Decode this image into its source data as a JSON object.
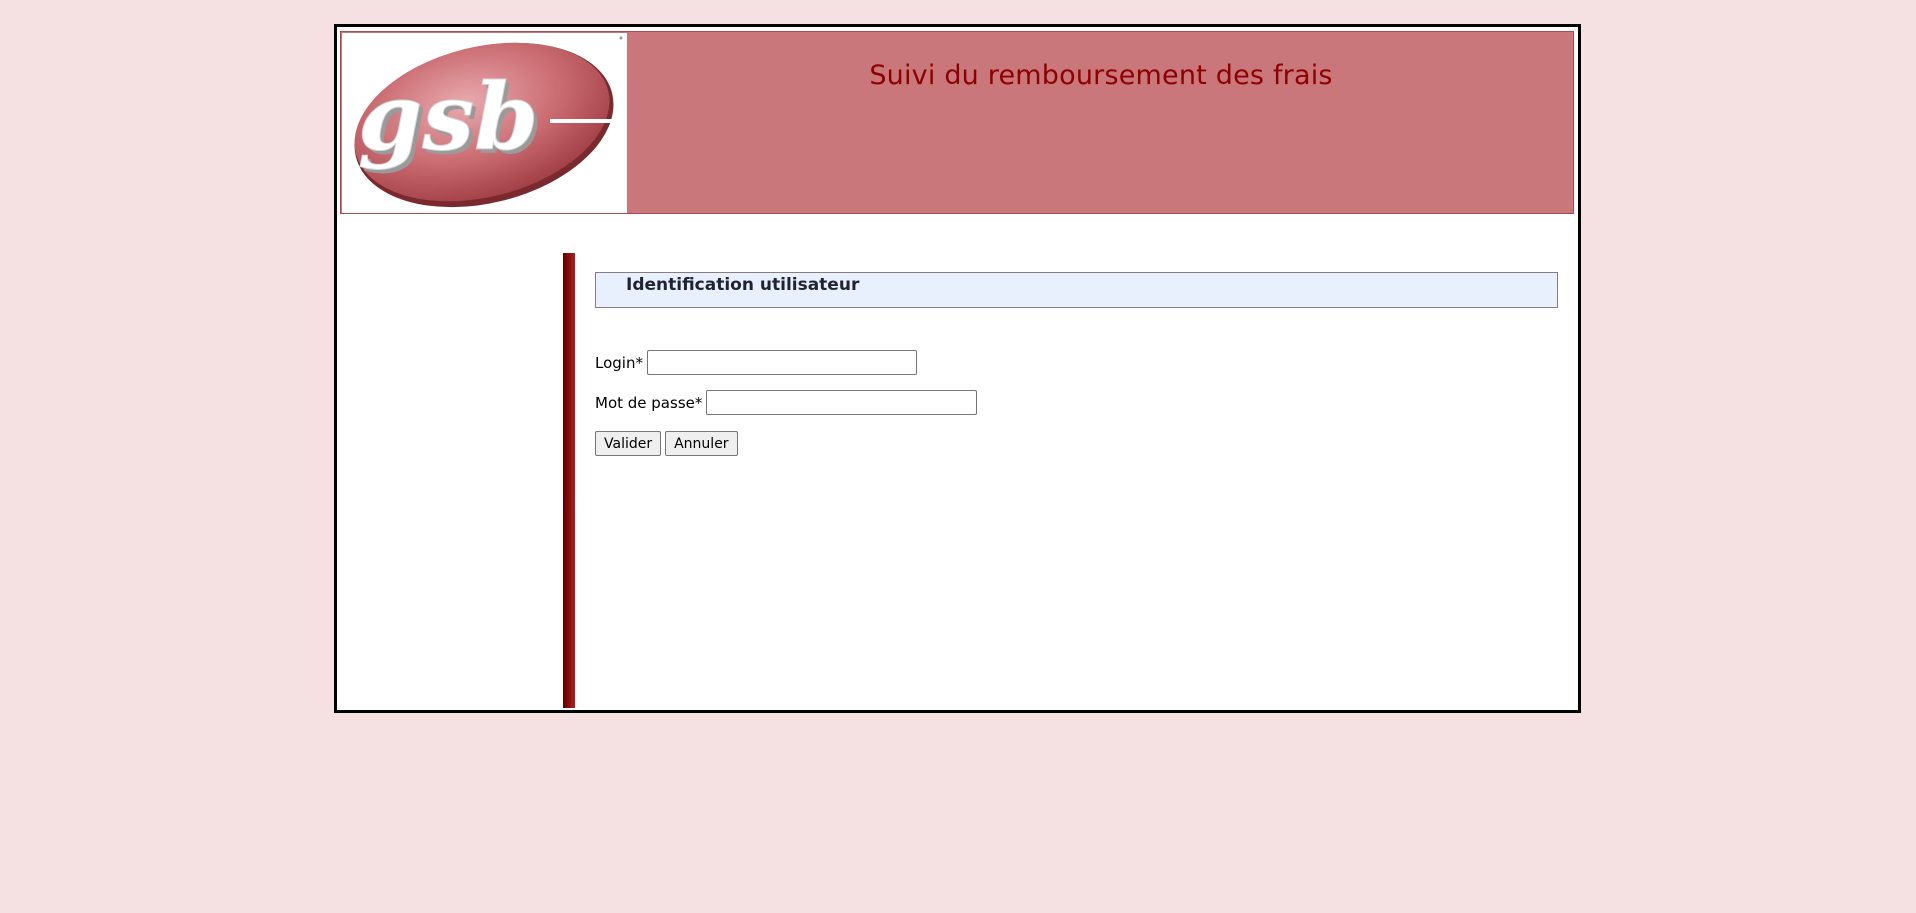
{
  "header": {
    "logo_text": "gsb",
    "title": "Suivi du remboursement des frais"
  },
  "form": {
    "heading": "Identification utilisateur",
    "login_label": "Login*",
    "login_value": "",
    "password_label": "Mot de passe*",
    "password_value": "",
    "submit_label": "Valider",
    "reset_label": "Annuler"
  },
  "colors": {
    "page_background": "#f5e1e2",
    "header_background": "#c9777a",
    "title_color": "#8f0000",
    "heading_box_background": "#e8f0fe",
    "divider_bar": "#8c1010"
  }
}
